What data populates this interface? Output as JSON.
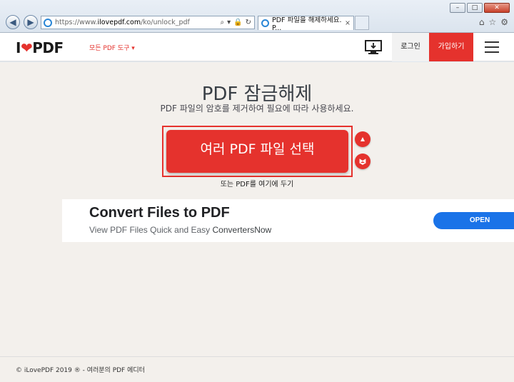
{
  "browser": {
    "url_prefix": "https://www.",
    "url_host": "ilovepdf.com",
    "url_path": "/ko/unlock_pdf",
    "tab_title": "PDF 파일을 해제하세요. P...",
    "back_icon": "back-arrow-icon",
    "forward_icon": "forward-arrow-icon",
    "minimize": "–",
    "maximize": "□",
    "close": "✕",
    "search_glyph": "⌕",
    "dropdown_glyph": "▾",
    "lock_glyph": "🔒",
    "refresh_glyph": "↻",
    "tab_close": "×",
    "home_glyph": "⌂",
    "star_glyph": "☆",
    "gear_glyph": "⚙"
  },
  "header": {
    "logo_i": "I",
    "logo_heart": "❤",
    "logo_pdf": "PDF",
    "all_tools": "모든 PDF 도구 ▾",
    "login": "로그인",
    "signup": "가입하기"
  },
  "main": {
    "title": "PDF 잠금해제",
    "subtitle": "PDF 파일의 암호를 제거하여 필요에 따라 사용하세요.",
    "select_button": "여러 PDF 파일 선택",
    "drop_hint": "또는 PDF를 여기에 두기"
  },
  "ad": {
    "title": "Convert Files to PDF",
    "subtitle": "View PDF Files Quick and Easy ",
    "brand": "ConvertersNow",
    "open": "OPEN"
  },
  "footer": {
    "text": "© iLovePDF 2019 ® - 여러분의 PDF 에디터"
  },
  "colors": {
    "brand_red": "#e5322d",
    "ad_blue": "#1a73e8"
  }
}
